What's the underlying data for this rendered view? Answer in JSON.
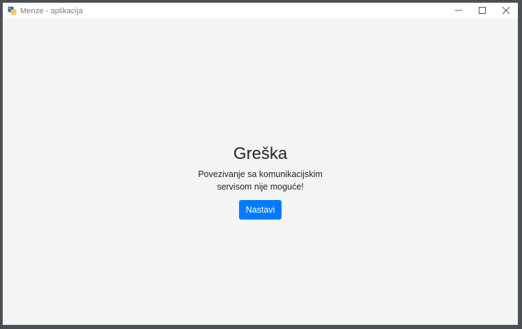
{
  "window": {
    "title": "Menze - aplikacija",
    "app_icon": "python-app-icon",
    "controls": {
      "minimize_icon": "minimize-icon",
      "maximize_icon": "maximize-icon",
      "close_icon": "close-icon"
    }
  },
  "dialog": {
    "title": "Greška",
    "message": "Povezivanje sa komunikacijskim servisom nije moguće!",
    "continue_label": "Nastavi"
  },
  "colors": {
    "accent": "#007bff",
    "background": "#f4f4f4",
    "titlebar": "#ffffff",
    "text": "#212529"
  }
}
